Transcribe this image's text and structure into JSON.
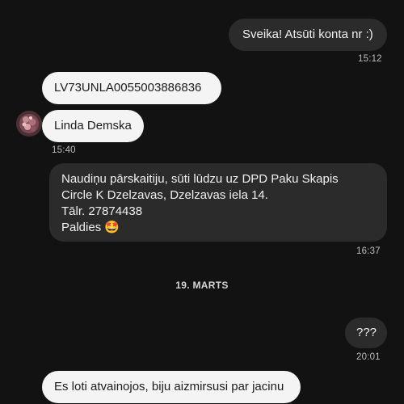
{
  "messages": [
    {
      "text": "Sveika! Atsūti konta nr :)",
      "time": "15:12"
    },
    {
      "text": "LV73UNLA0055003886836"
    },
    {
      "text": "Linda Demska",
      "time": "15:40"
    },
    {
      "text": "Naudiņu pārskaitiju, sūti lūdzu uz DPD Paku Skapis\nCircle K Dzelzavas, Dzelzavas iela 14.\nTālr. 27874438\nPaldies 🤩",
      "time": "16:37"
    },
    {
      "text": "???",
      "time": "20:01"
    },
    {
      "text": "Es loti atvainojos, biju aizmirsusi par jacinu"
    }
  ],
  "date_separator": "19. MARTS",
  "contact_avatar": "contact-avatar-icon"
}
